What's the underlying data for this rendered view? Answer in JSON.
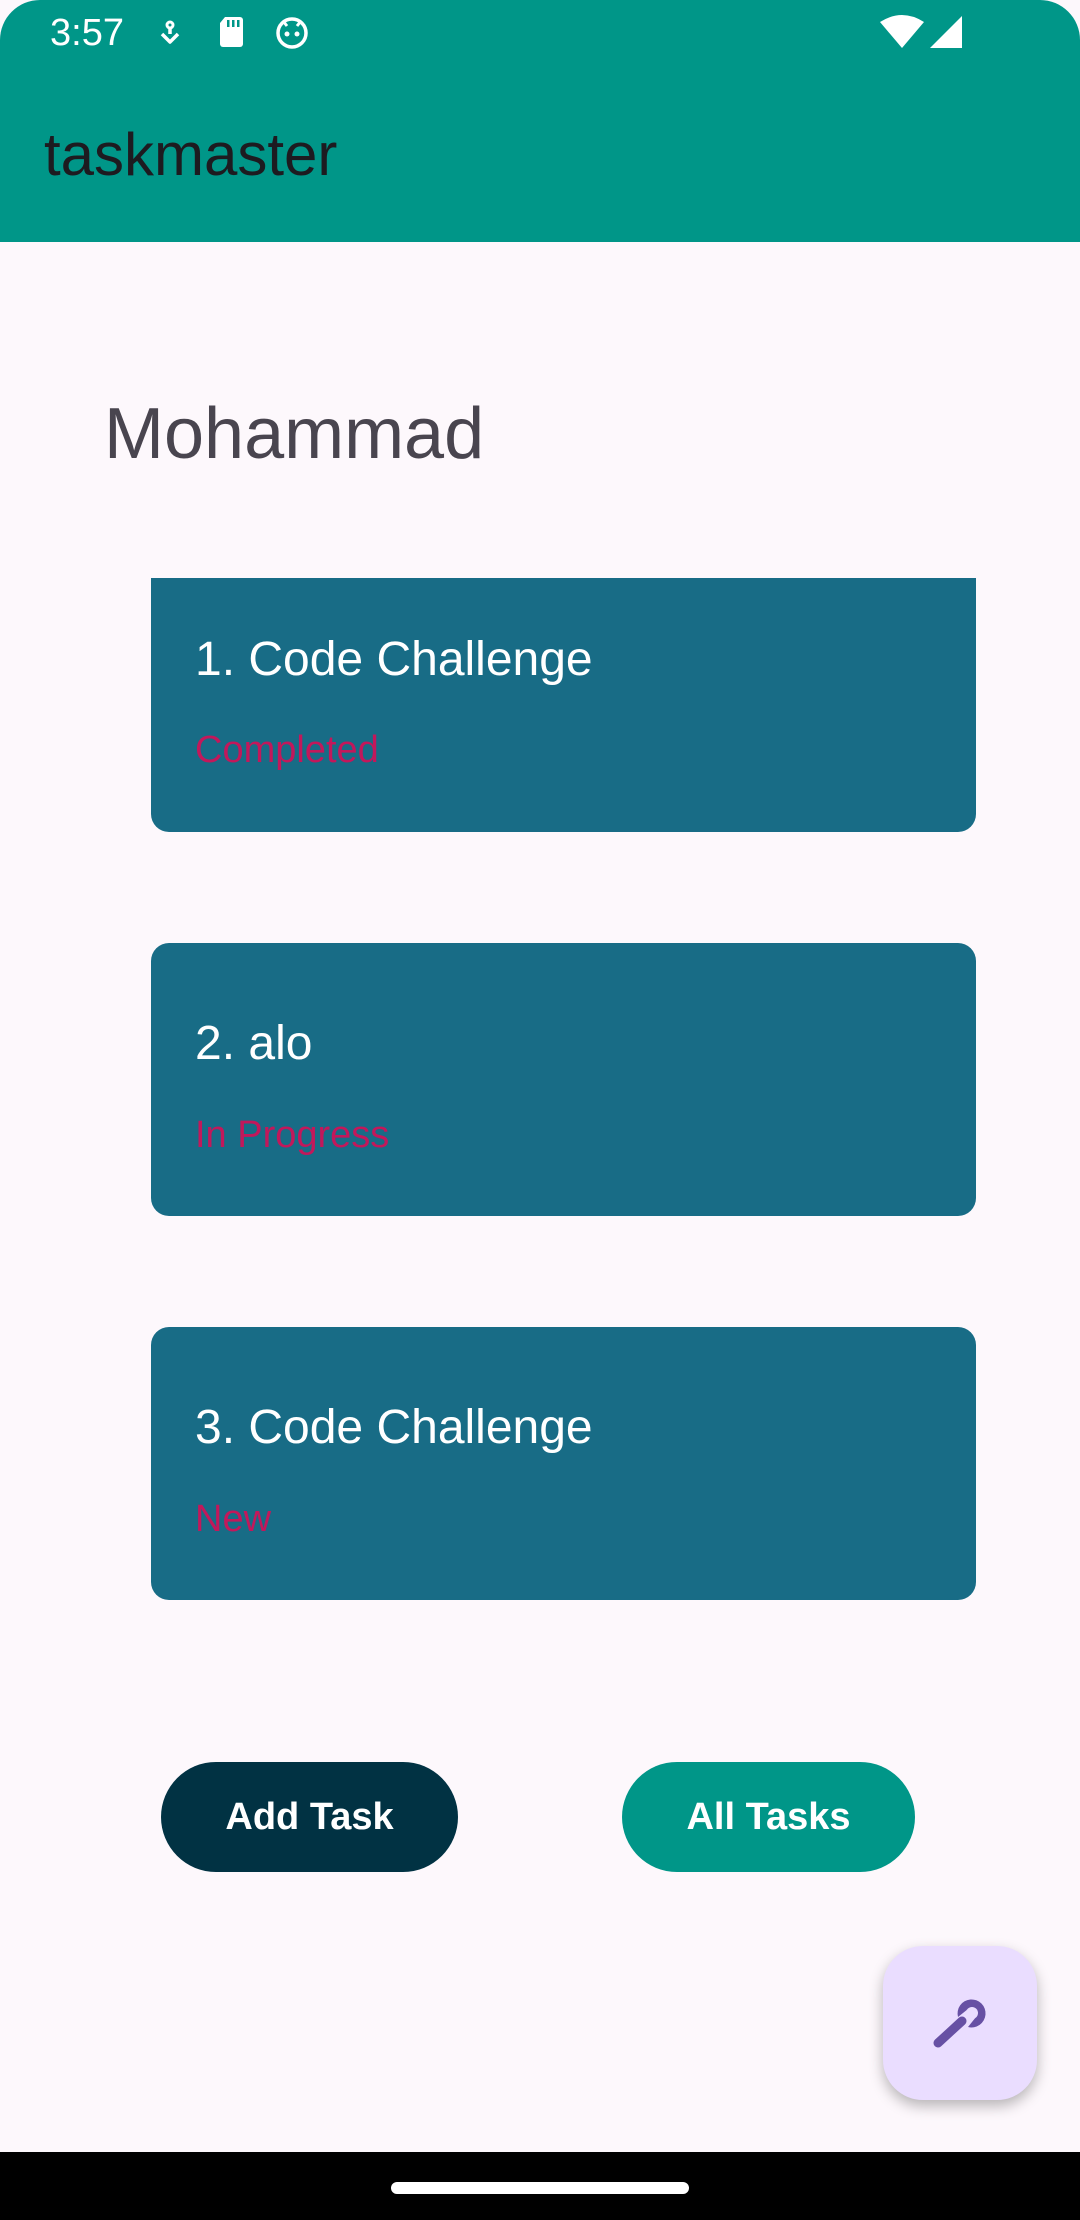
{
  "status_bar": {
    "time": "3:57",
    "icons_left": [
      "download-icon",
      "sd-card-icon",
      "android-icon"
    ],
    "icons_right": [
      "wifi-icon",
      "signal-icon"
    ]
  },
  "app_bar": {
    "title": "taskmaster",
    "color": "#009688"
  },
  "user": {
    "name": "Mohammad"
  },
  "tasks": [
    {
      "title": "1. Code Challenge",
      "status": "Completed"
    },
    {
      "title": "2. alo",
      "status": "In Progress"
    },
    {
      "title": "3. Code Challenge",
      "status": "New"
    }
  ],
  "actions": {
    "add_task": "Add Task",
    "all_tasks": "All Tasks"
  },
  "fab": {
    "icon": "wrench-icon",
    "color": "#eaddff"
  },
  "colors": {
    "card": "#186c86",
    "status_text": "#c2185b",
    "add_button": "#013243",
    "all_button": "#009688"
  }
}
